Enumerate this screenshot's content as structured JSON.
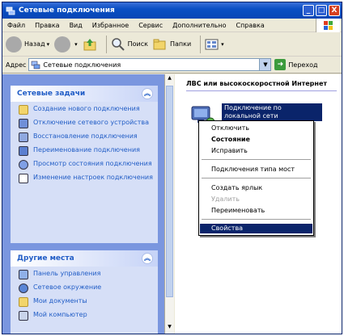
{
  "window": {
    "title": "Сетевые подключения",
    "minimize_label": "_",
    "maximize_label": "□",
    "close_label": "X"
  },
  "menubar": {
    "items": [
      "Файл",
      "Правка",
      "Вид",
      "Избранное",
      "Сервис",
      "Дополнительно",
      "Справка"
    ]
  },
  "toolbar": {
    "back_label": "Назад",
    "search_label": "Поиск",
    "folders_label": "Папки"
  },
  "address": {
    "label": "Адрес",
    "value": "Сетевые подключения",
    "go_label": "Переход"
  },
  "tasks_panel": {
    "title": "Сетевые задачи",
    "items": [
      {
        "label": "Создание нового подключения",
        "icon": "new-connection-icon"
      },
      {
        "label": "Отключение сетевого устройства",
        "icon": "disable-device-icon"
      },
      {
        "label": "Восстановление подключения",
        "icon": "repair-icon"
      },
      {
        "label": "Переименование подключения",
        "icon": "rename-icon"
      },
      {
        "label": "Просмотр состояния подключения",
        "icon": "status-icon"
      },
      {
        "label": "Изменение настроек подключения",
        "icon": "settings-icon"
      }
    ]
  },
  "places_panel": {
    "title": "Другие места",
    "items": [
      {
        "label": "Панель управления",
        "icon": "control-panel-icon"
      },
      {
        "label": "Сетевое окружение",
        "icon": "network-places-icon"
      },
      {
        "label": "Мои документы",
        "icon": "my-documents-icon"
      },
      {
        "label": "Мой компьютер",
        "icon": "my-computer-icon"
      }
    ]
  },
  "main": {
    "group_header": "ЛВС или высокоскоростной Интернет",
    "connection_label": "Подключение по локальной сети"
  },
  "context_menu": {
    "items": [
      {
        "label": "Отключить",
        "style": "normal"
      },
      {
        "label": "Состояние",
        "style": "bold"
      },
      {
        "label": "Исправить",
        "style": "normal"
      },
      {
        "label": "Подключения типа мост",
        "style": "normal"
      },
      {
        "label": "Создать ярлык",
        "style": "normal"
      },
      {
        "label": "Удалить",
        "style": "disabled"
      },
      {
        "label": "Переименовать",
        "style": "normal"
      },
      {
        "label": "Свойства",
        "style": "selected"
      }
    ]
  },
  "colors": {
    "title_bar": "#0a4fc4",
    "task_pane_bg": "#7a96df",
    "link_text": "#215dc6",
    "selection": "#0a246a"
  }
}
